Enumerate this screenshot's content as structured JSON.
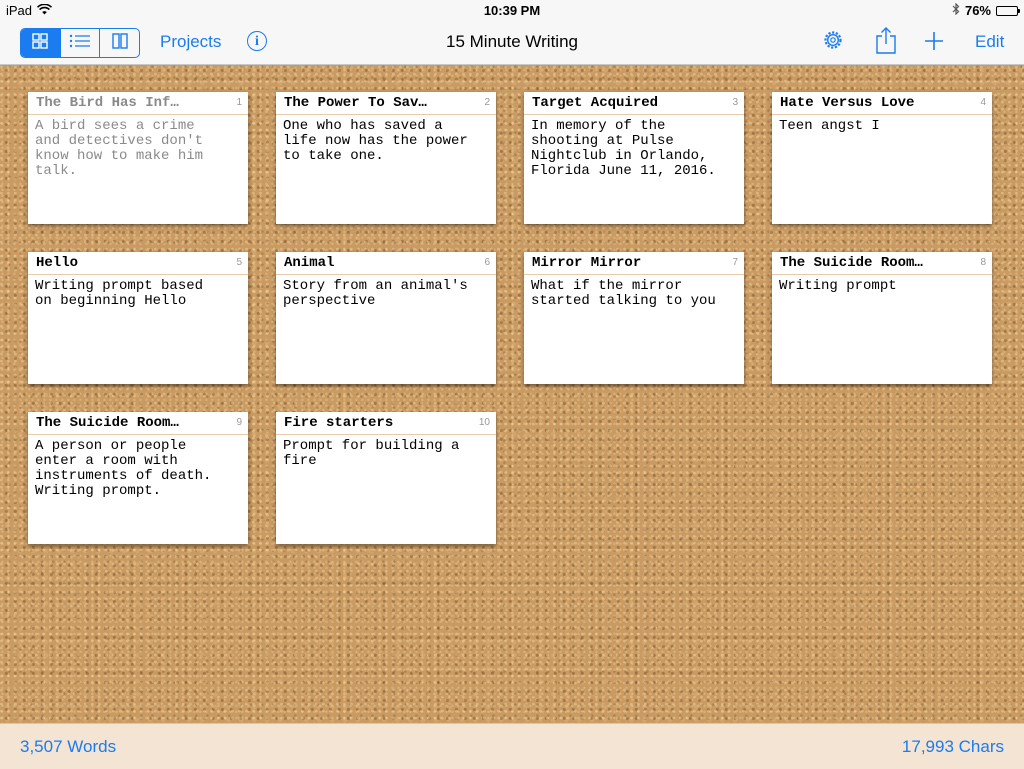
{
  "status_bar": {
    "device": "iPad",
    "time": "10:39 PM",
    "battery": "76%",
    "battery_level": 0.76
  },
  "toolbar": {
    "projects_label": "Projects",
    "title": "15 Minute Writing",
    "edit_label": "Edit",
    "view_modes": [
      "grid",
      "list",
      "columns"
    ],
    "selected_view": "grid"
  },
  "cards": [
    {
      "title": "The Bird Has Inf…",
      "number": "1",
      "body": "A bird sees a crime\nand detectives don't\nknow how to make him\ntalk.",
      "dimmed": true
    },
    {
      "title": "The Power To Sav…",
      "number": "2",
      "body": "One who has saved a\nlife now has the power\nto take one.",
      "dimmed": false
    },
    {
      "title": "Target Acquired",
      "number": "3",
      "body": "In memory of the\nshooting at Pulse\nNightclub in Orlando,\nFlorida June 11, 2016.",
      "dimmed": false
    },
    {
      "title": "Hate Versus Love",
      "number": "4",
      "body": "Teen angst I",
      "dimmed": false
    },
    {
      "title": "Hello",
      "number": "5",
      "body": "Writing prompt based\non beginning Hello",
      "dimmed": false
    },
    {
      "title": "Animal",
      "number": "6",
      "body": "Story from an animal's\nperspective",
      "dimmed": false
    },
    {
      "title": "Mirror Mirror",
      "number": "7",
      "body": "What if the mirror\nstarted talking to you",
      "dimmed": false
    },
    {
      "title": "The Suicide Room…",
      "number": "8",
      "body": "Writing prompt",
      "dimmed": false
    },
    {
      "title": "The Suicide Room…",
      "number": "9",
      "body": "A person or people\nenter a room with\ninstruments of death.\nWriting prompt.",
      "dimmed": false
    },
    {
      "title": "Fire starters",
      "number": "10",
      "body": "Prompt for building a\nfire",
      "dimmed": false
    }
  ],
  "bottom_bar": {
    "words": "3,507 Words",
    "chars": "17,993 Chars"
  },
  "colors": {
    "accent": "#1a7cf0",
    "cork": "#c99a61",
    "bottom_bar": "#f3e4d3"
  }
}
